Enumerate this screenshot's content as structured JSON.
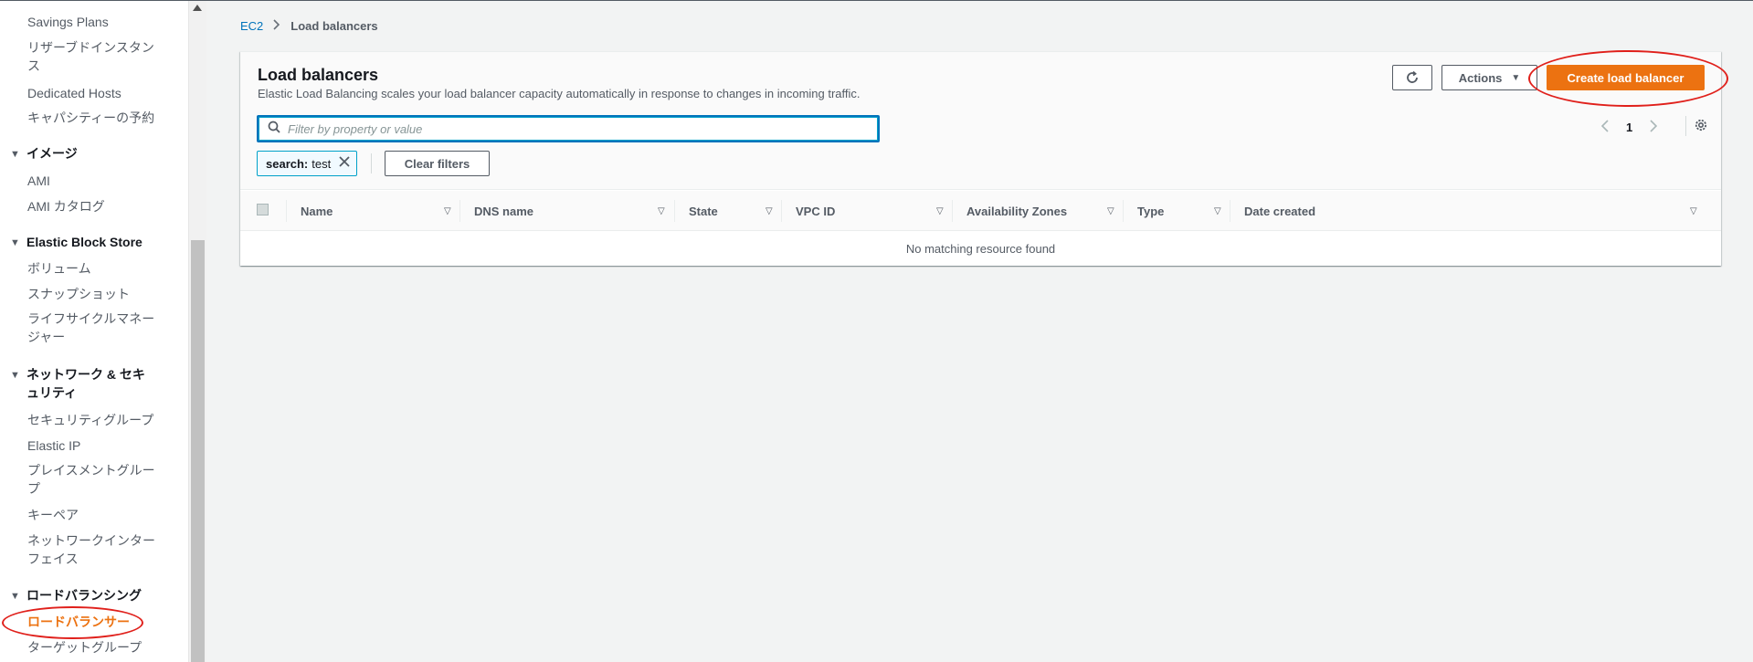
{
  "sidebar": {
    "items": [
      {
        "type": "link",
        "label": "Savings Plans"
      },
      {
        "type": "link",
        "label": "リザーブドインスタンス"
      },
      {
        "type": "link",
        "label": "Dedicated Hosts"
      },
      {
        "type": "link",
        "label": "キャパシティーの予約"
      },
      {
        "type": "section",
        "label": "イメージ"
      },
      {
        "type": "link",
        "label": "AMI"
      },
      {
        "type": "link",
        "label": "AMI カタログ"
      },
      {
        "type": "section",
        "label": "Elastic Block Store"
      },
      {
        "type": "link",
        "label": "ボリューム"
      },
      {
        "type": "link",
        "label": "スナップショット"
      },
      {
        "type": "link",
        "label": "ライフサイクルマネージャー"
      },
      {
        "type": "section",
        "label": "ネットワーク & セキュリティ"
      },
      {
        "type": "link",
        "label": "セキュリティグループ"
      },
      {
        "type": "link",
        "label": "Elastic IP"
      },
      {
        "type": "link",
        "label": "プレイスメントグループ"
      },
      {
        "type": "link",
        "label": "キーペア"
      },
      {
        "type": "link",
        "label": "ネットワークインターフェイス"
      },
      {
        "type": "section",
        "label": "ロードバランシング"
      },
      {
        "type": "link",
        "label": "ロードバランサー",
        "active": true
      },
      {
        "type": "link",
        "label": "ターゲットグループ"
      }
    ]
  },
  "breadcrumb": {
    "root": "EC2",
    "current": "Load balancers"
  },
  "panel": {
    "title": "Load balancers",
    "description": "Elastic Load Balancing scales your load balancer capacity automatically in response to changes in incoming traffic.",
    "actions_label": "Actions",
    "create_label": "Create load balancer",
    "filter_placeholder": "Filter by property or value",
    "token_key": "search:",
    "token_value": "test",
    "clear_filters_label": "Clear filters",
    "page_number": "1"
  },
  "table": {
    "columns": [
      "Name",
      "DNS name",
      "State",
      "VPC ID",
      "Availability Zones",
      "Type",
      "Date created"
    ],
    "empty_message": "No matching resource found"
  },
  "colors": {
    "accent": "#ec7211",
    "link": "#0073bb",
    "annotation": "#e0201b"
  }
}
